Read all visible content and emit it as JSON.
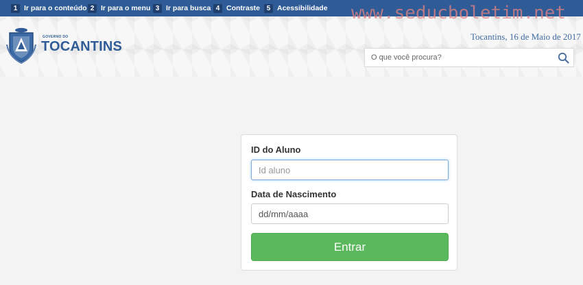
{
  "accessibility_bar": {
    "links": [
      {
        "number": "1",
        "label": "Ir para o conteúdo"
      },
      {
        "number": "2",
        "label": "Ir para o menu"
      },
      {
        "number": "3",
        "label": "Ir para busca"
      },
      {
        "number": "4",
        "label": "Contraste"
      },
      {
        "number": "5",
        "label": "Acessibilidade"
      }
    ]
  },
  "watermark": "www.seducboletim.net",
  "header": {
    "logo_small_text": "GOVERNO DO",
    "logo_big_text": "TOCANTINS",
    "date_text": "Tocantins, 16 de Maio de 2017 -",
    "search_placeholder": "O que você procura?",
    "search_icon": "magnifier-icon"
  },
  "form": {
    "student_id_label": "ID do Aluno",
    "student_id_placeholder": "Id aluno",
    "birth_date_label": "Data de Nascimento",
    "birth_date_placeholder": "dd/mm/aaaa",
    "submit_label": "Entrar"
  },
  "colors": {
    "top_bar": "#2f5c96",
    "brand_blue": "#2f5c96",
    "submit_green": "#5cb85c",
    "watermark": "#e18282"
  }
}
